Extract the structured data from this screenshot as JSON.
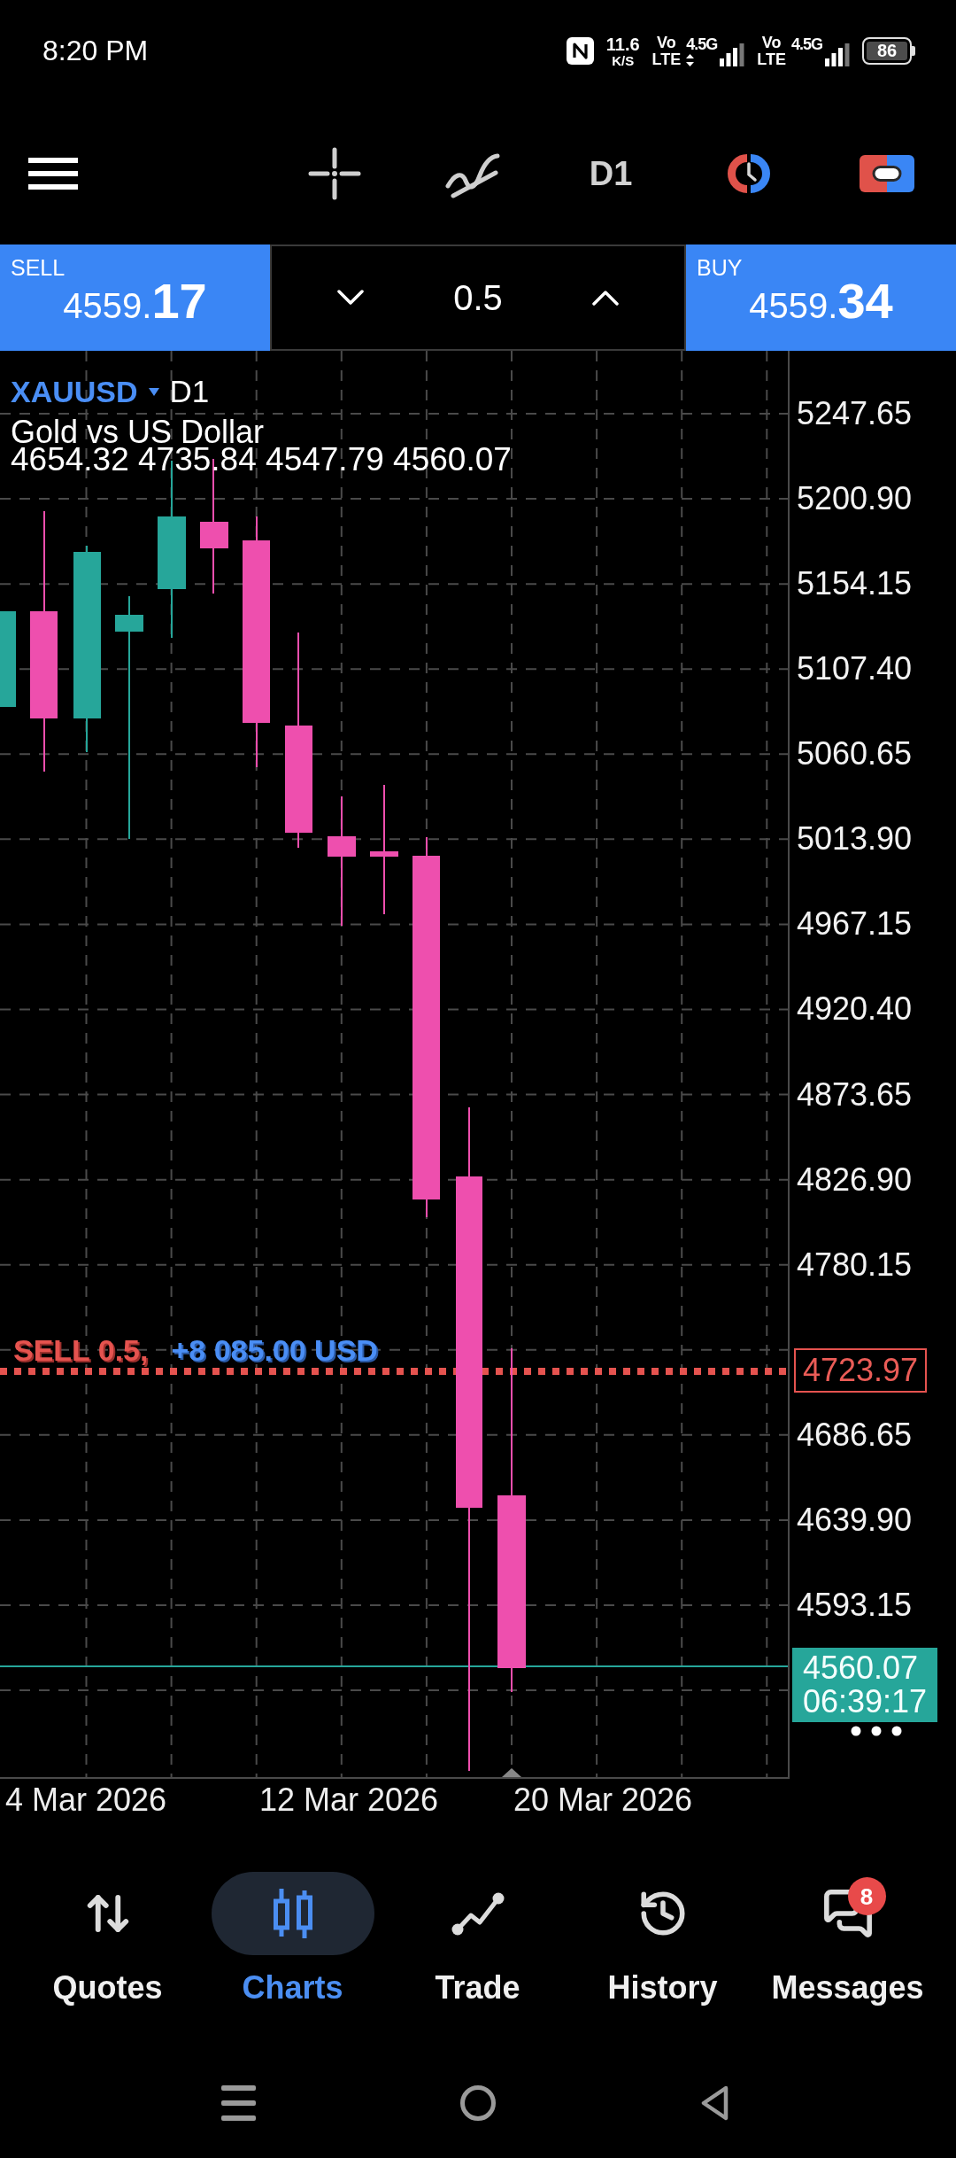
{
  "status_bar": {
    "time": "8:20 PM",
    "net_speed": {
      "value": "11.6",
      "unit": "K/S"
    },
    "sims": [
      {
        "volte_top": "Vo",
        "volte_bottom": "LTE",
        "network": "4.5G",
        "data_activity": true
      },
      {
        "volte_top": "Vo",
        "volte_bottom": "LTE",
        "network": "4.5G",
        "data_activity": false
      }
    ],
    "battery": "86"
  },
  "toolbar": {
    "timeframe": "D1"
  },
  "trade_panel": {
    "sell": {
      "label": "SELL",
      "price": "4559.",
      "price_large": "17"
    },
    "volume": "0.5",
    "buy": {
      "label": "BUY",
      "price": "4559.",
      "price_large": "34"
    }
  },
  "chart": {
    "symbol": "XAUUSD",
    "timeframe": "D1",
    "description": "Gold vs US Dollar",
    "ohlc": "4654.32 4735.84 4547.79 4560.07",
    "price_scale": {
      "above_order": [
        "5247.65",
        "5200.90",
        "5154.15",
        "5107.40",
        "5060.65",
        "5013.90",
        "4967.15",
        "4920.40",
        "4873.65",
        "4826.90",
        "4780.15"
      ],
      "below_order": [
        "4686.65",
        "4639.90",
        "4593.15"
      ]
    },
    "order": {
      "side": "SELL 0.5,",
      "profit": "+8 085.00 USD",
      "price": "4723.97"
    },
    "last_price": {
      "price": "4560.07",
      "countdown": "06:39:17"
    },
    "dates": [
      "4 Mar 2026",
      "12 Mar 2026",
      "20 Mar 2026"
    ]
  },
  "bottom_nav": [
    {
      "label": "Quotes",
      "selected": false
    },
    {
      "label": "Charts",
      "selected": true
    },
    {
      "label": "Trade",
      "selected": false
    },
    {
      "label": "History",
      "selected": false
    },
    {
      "label": "Messages",
      "selected": false,
      "badge": "8"
    }
  ]
}
